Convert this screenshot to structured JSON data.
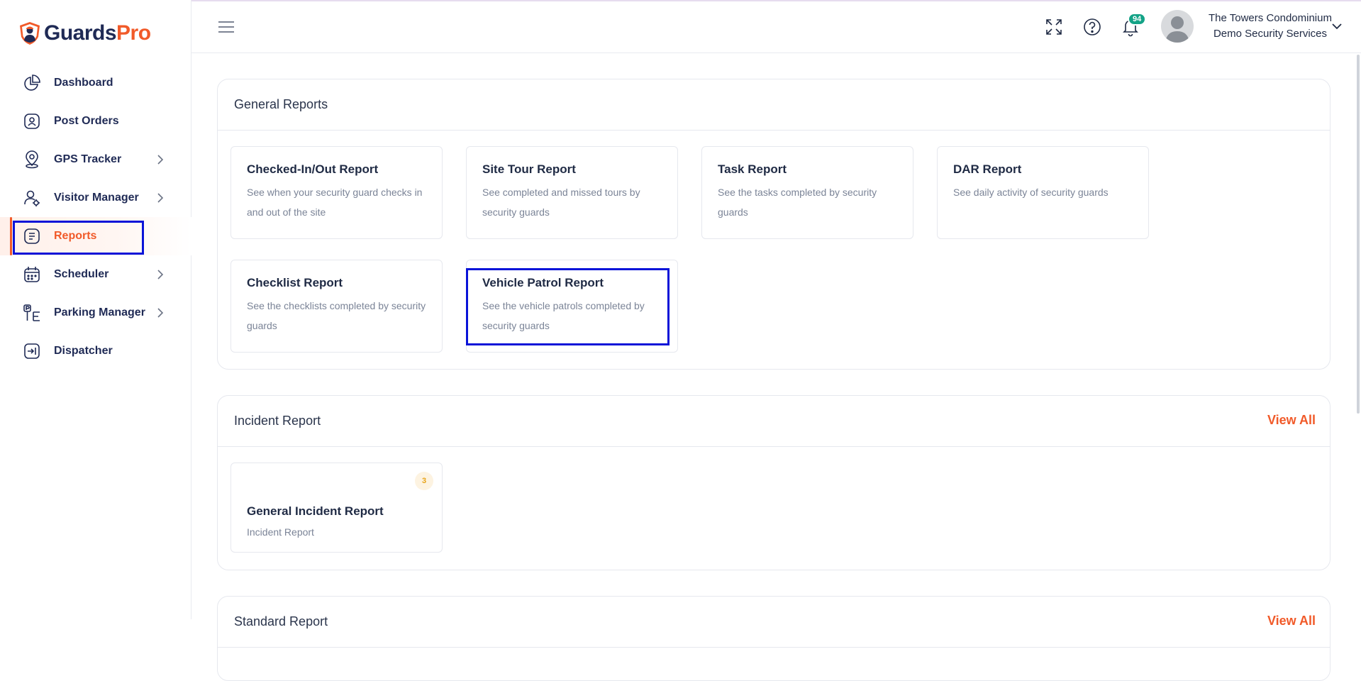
{
  "app": {
    "logo_part1": "Guards",
    "logo_part2": "Pro"
  },
  "sidebar": {
    "items": [
      {
        "label": "Dashboard",
        "icon": "dashboard-pie-icon",
        "has_chevron": false,
        "active": false
      },
      {
        "label": "Post Orders",
        "icon": "post-orders-icon",
        "has_chevron": false,
        "active": false
      },
      {
        "label": "GPS Tracker",
        "icon": "map-pin-icon",
        "has_chevron": true,
        "active": false
      },
      {
        "label": "Visitor Manager",
        "icon": "visitor-icon",
        "has_chevron": true,
        "active": false
      },
      {
        "label": "Reports",
        "icon": "reports-icon",
        "has_chevron": false,
        "active": true
      },
      {
        "label": "Scheduler",
        "icon": "calendar-icon",
        "has_chevron": true,
        "active": false
      },
      {
        "label": "Parking Manager",
        "icon": "parking-icon",
        "has_chevron": true,
        "active": false
      },
      {
        "label": "Dispatcher",
        "icon": "dispatcher-icon",
        "has_chevron": false,
        "active": false
      }
    ]
  },
  "header": {
    "notification_count": "94",
    "user_line1": "The Towers Condominium",
    "user_line2": "Demo Security Services"
  },
  "general_reports": {
    "title": "General Reports",
    "cards": [
      {
        "title": "Checked-In/Out Report",
        "desc": "See when your security guard checks in and out of the site"
      },
      {
        "title": "Site Tour Report",
        "desc": "See completed and missed tours by security guards"
      },
      {
        "title": "Task Report",
        "desc": "See the tasks completed by security guards"
      },
      {
        "title": "DAR Report",
        "desc": "See daily activity of security guards"
      },
      {
        "title": "Checklist Report",
        "desc": "See the checklists completed by security guards"
      },
      {
        "title": "Vehicle Patrol Report",
        "desc": "See the vehicle patrols completed by security guards"
      }
    ]
  },
  "incident_report": {
    "title": "Incident Report",
    "view_all": "View All",
    "cards": [
      {
        "title": "General Incident Report",
        "desc": "Incident Report",
        "count": "3"
      }
    ]
  },
  "standard_report": {
    "title": "Standard Report",
    "view_all": "View All"
  },
  "colors": {
    "accent": "#f15a29",
    "navy": "#1f2a55",
    "highlight": "#0a14d8",
    "badge": "#14a387"
  }
}
